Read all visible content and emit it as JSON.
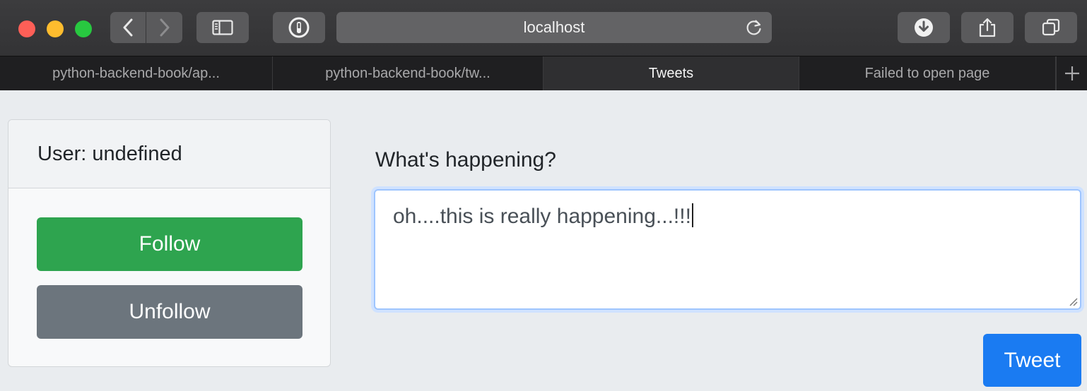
{
  "browser": {
    "address": "localhost",
    "colors": {
      "close": "#fe5f57",
      "minimize": "#febc2e",
      "zoom": "#28c840"
    },
    "toolbar_icons": [
      "back-icon",
      "forward-icon",
      "sidebar-icon",
      "password-icon",
      "reload-icon",
      "download-icon",
      "share-icon",
      "tabs-overview-icon"
    ],
    "tabs": [
      {
        "label": "python-backend-book/ap...",
        "active": false
      },
      {
        "label": "python-backend-book/tw...",
        "active": false
      },
      {
        "label": "Tweets",
        "active": true
      },
      {
        "label": "Failed to open page",
        "active": false
      }
    ]
  },
  "profile": {
    "user_label": "User: undefined",
    "follow_label": "Follow",
    "unfollow_label": "Unfollow",
    "colors": {
      "follow": "#2ea44f",
      "unfollow": "#6c757d"
    }
  },
  "composer": {
    "prompt": "What's happening?",
    "text": "oh....this is really happening...!!!",
    "tweet_label": "Tweet",
    "colors": {
      "tweet": "#1a7bf2",
      "focus": "#9ec5fe"
    }
  }
}
